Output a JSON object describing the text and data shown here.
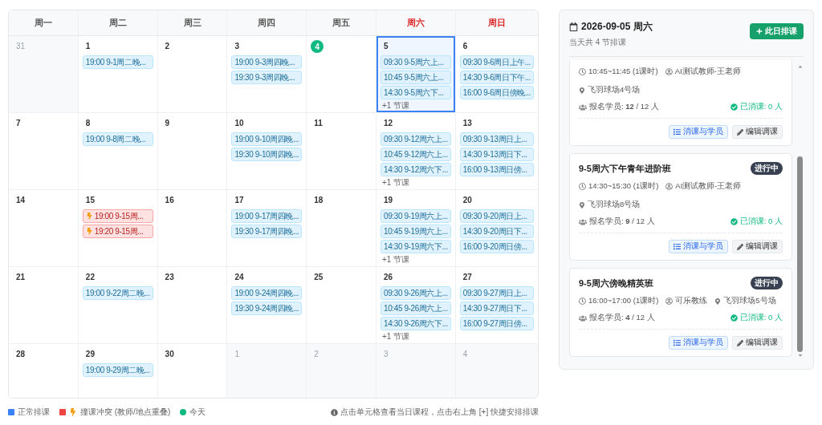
{
  "calendar": {
    "weekdays": [
      {
        "label": "周一",
        "weekend": false
      },
      {
        "label": "周二",
        "weekend": false
      },
      {
        "label": "周三",
        "weekend": false
      },
      {
        "label": "周四",
        "weekend": false
      },
      {
        "label": "周五",
        "weekend": false
      },
      {
        "label": "周六",
        "weekend": true
      },
      {
        "label": "周日",
        "weekend": true
      }
    ],
    "weeks": [
      [
        {
          "day": "31",
          "in_month": false,
          "today": false,
          "selected": false
        },
        {
          "day": "1",
          "in_month": true,
          "today": false,
          "selected": false,
          "events": [
            {
              "kind": "normal",
              "text": "19:00 9-1周二晚..."
            }
          ]
        },
        {
          "day": "2",
          "in_month": true,
          "today": false,
          "selected": false
        },
        {
          "day": "3",
          "in_month": true,
          "today": false,
          "selected": false,
          "events": [
            {
              "kind": "normal",
              "text": "19:00 9-3周四晚..."
            },
            {
              "kind": "normal",
              "text": "19:30 9-3周四晚..."
            }
          ]
        },
        {
          "day": "4",
          "in_month": true,
          "today": true,
          "selected": false
        },
        {
          "day": "5",
          "in_month": true,
          "today": false,
          "selected": true,
          "events": [
            {
              "kind": "normal",
              "text": "09:30 9-5周六上..."
            },
            {
              "kind": "normal",
              "text": "10:45 9-5周六上..."
            },
            {
              "kind": "normal",
              "text": "14:30 9-5周六下..."
            }
          ],
          "more": "+1 节课"
        },
        {
          "day": "6",
          "in_month": true,
          "today": false,
          "selected": false,
          "events": [
            {
              "kind": "normal",
              "text": "09:30 9-6周日上午..."
            },
            {
              "kind": "normal",
              "text": "14:30 9-6周日下午..."
            },
            {
              "kind": "normal",
              "text": "16:00 9-6周日傍晚..."
            }
          ]
        }
      ],
      [
        {
          "day": "7",
          "in_month": true,
          "today": false,
          "selected": false
        },
        {
          "day": "8",
          "in_month": true,
          "today": false,
          "selected": false,
          "events": [
            {
              "kind": "normal",
              "text": "19:00 9-8周二晚..."
            }
          ]
        },
        {
          "day": "9",
          "in_month": true,
          "today": false,
          "selected": false
        },
        {
          "day": "10",
          "in_month": true,
          "today": false,
          "selected": false,
          "events": [
            {
              "kind": "normal",
              "text": "19:00 9-10周四晚..."
            },
            {
              "kind": "normal",
              "text": "19:30 9-10周四晚..."
            }
          ]
        },
        {
          "day": "11",
          "in_month": true,
          "today": false,
          "selected": false
        },
        {
          "day": "12",
          "in_month": true,
          "today": false,
          "selected": false,
          "events": [
            {
              "kind": "normal",
              "text": "09:30 9-12周六上..."
            },
            {
              "kind": "normal",
              "text": "10:45 9-12周六上..."
            },
            {
              "kind": "normal",
              "text": "14:30 9-12周六下..."
            }
          ],
          "more": "+1 节课"
        },
        {
          "day": "13",
          "in_month": true,
          "today": false,
          "selected": false,
          "events": [
            {
              "kind": "normal",
              "text": "09:30 9-13周日上..."
            },
            {
              "kind": "normal",
              "text": "14:30 9-13周日下..."
            },
            {
              "kind": "normal",
              "text": "16:00 9-13周日傍..."
            }
          ]
        }
      ],
      [
        {
          "day": "14",
          "in_month": true,
          "today": false,
          "selected": false
        },
        {
          "day": "15",
          "in_month": true,
          "today": false,
          "selected": false,
          "events": [
            {
              "kind": "conflict",
              "text": "19:00 9-15周..."
            },
            {
              "kind": "conflict",
              "text": "19:20 9-15周..."
            }
          ]
        },
        {
          "day": "16",
          "in_month": true,
          "today": false,
          "selected": false
        },
        {
          "day": "17",
          "in_month": true,
          "today": false,
          "selected": false,
          "events": [
            {
              "kind": "normal",
              "text": "19:00 9-17周四晚..."
            },
            {
              "kind": "normal",
              "text": "19:30 9-17周四晚..."
            }
          ]
        },
        {
          "day": "18",
          "in_month": true,
          "today": false,
          "selected": false
        },
        {
          "day": "19",
          "in_month": true,
          "today": false,
          "selected": false,
          "events": [
            {
              "kind": "normal",
              "text": "09:30 9-19周六上..."
            },
            {
              "kind": "normal",
              "text": "10:45 9-19周六上..."
            },
            {
              "kind": "normal",
              "text": "14:30 9-19周六下..."
            }
          ],
          "more": "+1 节课"
        },
        {
          "day": "20",
          "in_month": true,
          "today": false,
          "selected": false,
          "events": [
            {
              "kind": "normal",
              "text": "09:30 9-20周日上..."
            },
            {
              "kind": "normal",
              "text": "14:30 9-20周日下..."
            },
            {
              "kind": "normal",
              "text": "16:00 9-20周日傍..."
            }
          ]
        }
      ],
      [
        {
          "day": "21",
          "in_month": true,
          "today": false,
          "selected": false
        },
        {
          "day": "22",
          "in_month": true,
          "today": false,
          "selected": false,
          "events": [
            {
              "kind": "normal",
              "text": "19:00 9-22周二晚..."
            }
          ]
        },
        {
          "day": "23",
          "in_month": true,
          "today": false,
          "selected": false
        },
        {
          "day": "24",
          "in_month": true,
          "today": false,
          "selected": false,
          "events": [
            {
              "kind": "normal",
              "text": "19:00 9-24周四晚..."
            },
            {
              "kind": "normal",
              "text": "19:30 9-24周四晚..."
            }
          ]
        },
        {
          "day": "25",
          "in_month": true,
          "today": false,
          "selected": false
        },
        {
          "day": "26",
          "in_month": true,
          "today": false,
          "selected": false,
          "events": [
            {
              "kind": "normal",
              "text": "09:30 9-26周六上..."
            },
            {
              "kind": "normal",
              "text": "10:45 9-26周六上..."
            },
            {
              "kind": "normal",
              "text": "14:30 9-26周六下..."
            }
          ],
          "more": "+1 节课"
        },
        {
          "day": "27",
          "in_month": true,
          "today": false,
          "selected": false,
          "events": [
            {
              "kind": "normal",
              "text": "09:30 9-27周日上..."
            },
            {
              "kind": "normal",
              "text": "14:30 9-27周日下..."
            },
            {
              "kind": "normal",
              "text": "16:00 9-27周日傍..."
            }
          ]
        }
      ],
      [
        {
          "day": "28",
          "in_month": true,
          "today": false,
          "selected": false
        },
        {
          "day": "29",
          "in_month": true,
          "today": false,
          "selected": false,
          "events": [
            {
              "kind": "normal",
              "text": "19:00 9-29周二晚..."
            }
          ]
        },
        {
          "day": "30",
          "in_month": true,
          "today": false,
          "selected": false
        },
        {
          "day": "1",
          "in_month": false,
          "today": false,
          "selected": false
        },
        {
          "day": "2",
          "in_month": false,
          "today": false,
          "selected": false
        },
        {
          "day": "3",
          "in_month": false,
          "today": false,
          "selected": false
        },
        {
          "day": "4",
          "in_month": false,
          "today": false,
          "selected": false
        }
      ]
    ]
  },
  "legend": {
    "items": [
      {
        "kind": "square",
        "color": "#3b82f6",
        "label": "正常排课"
      },
      {
        "kind": "conflict",
        "color": "#ef4444",
        "label": "撞课冲突 (教师/地点重叠)"
      },
      {
        "kind": "dot",
        "color": "#10b981",
        "label": "今天"
      }
    ],
    "hint": "点击单元格查看当日课程，点击右上角 [+] 快捷安排排课"
  },
  "day_panel": {
    "title": "2026-09-05 周六",
    "subtitle": "当天共 4 节排课",
    "add_button": "此日排课",
    "lessons": [
      {
        "cut_top": true,
        "time": "10:45~11:45 (1课时)",
        "teacher": "AI测试教师-王老师",
        "venue": "飞羽球场4号场",
        "enrolled": "报名学员: **12** / 12 人",
        "consumed": "已消课: 0 人",
        "buttons": [
          "消课与学员",
          "编辑调课"
        ]
      },
      {
        "cut_top": false,
        "title": "9-5周六下午青年进阶班",
        "status": "进行中",
        "time": "14:30~15:30 (1课时)",
        "teacher": "AI测试教师-王老师",
        "venue": "飞羽球场8号场",
        "enrolled": "报名学员: **9** / 12 人",
        "consumed": "已消课: 0 人",
        "buttons": [
          "消课与学员",
          "编辑调课"
        ]
      },
      {
        "cut_top": false,
        "title": "9-5周六傍晚精英班",
        "status": "进行中",
        "time": "16:00~17:00 (1课时)",
        "teacher": "可乐教练",
        "venue": "飞羽球场5号场",
        "enrolled": "报名学员: **4** / 12 人",
        "consumed": "已消课: 0 人",
        "buttons": [
          "消课与学员",
          "编辑调课"
        ]
      }
    ]
  }
}
